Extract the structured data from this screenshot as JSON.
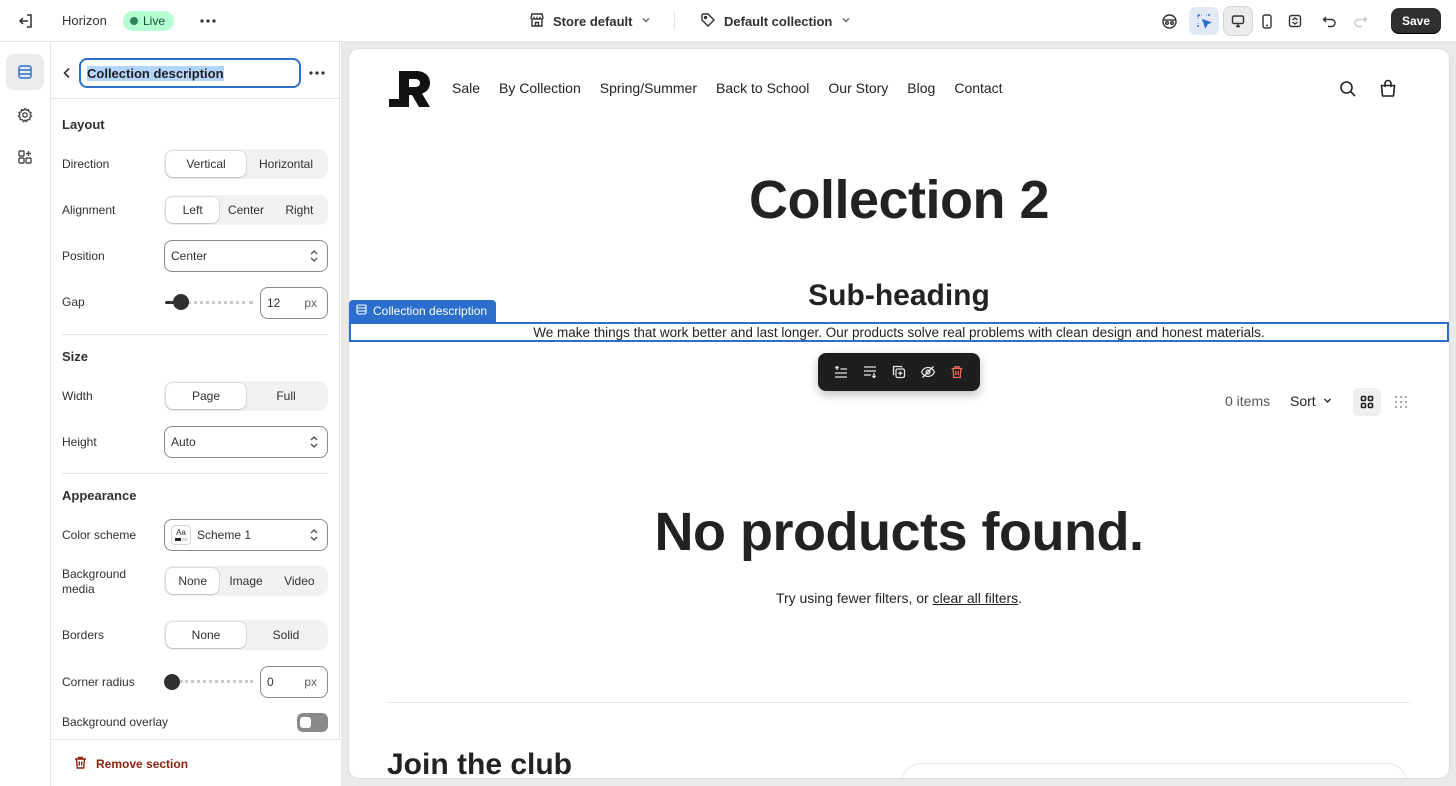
{
  "topbar": {
    "theme_name": "Horizon",
    "live_label": "Live",
    "store_select": "Store default",
    "collection_select": "Default collection",
    "save_label": "Save"
  },
  "panel": {
    "title_value": "Collection description",
    "layout": {
      "title": "Layout",
      "direction_label": "Direction",
      "direction_options": [
        "Vertical",
        "Horizontal"
      ],
      "direction_selected": "Vertical",
      "alignment_label": "Alignment",
      "alignment_options": [
        "Left",
        "Center",
        "Right"
      ],
      "alignment_selected": "Left",
      "position_label": "Position",
      "position_value": "Center",
      "gap_label": "Gap",
      "gap_value": "12",
      "gap_unit": "px"
    },
    "size": {
      "title": "Size",
      "width_label": "Width",
      "width_options": [
        "Page",
        "Full"
      ],
      "width_selected": "Page",
      "height_label": "Height",
      "height_value": "Auto"
    },
    "appearance": {
      "title": "Appearance",
      "color_scheme_label": "Color scheme",
      "color_scheme_swatch": "Aa",
      "color_scheme_value": "Scheme 1",
      "bg_media_label": "Background media",
      "bg_media_options": [
        "None",
        "Image",
        "Video"
      ],
      "bg_media_selected": "None",
      "borders_label": "Borders",
      "borders_options": [
        "None",
        "Solid"
      ],
      "borders_selected": "None",
      "corner_radius_label": "Corner radius",
      "corner_radius_value": "0",
      "corner_radius_unit": "px",
      "bg_overlay_label": "Background overlay",
      "bg_overlay_on": false
    },
    "remove_label": "Remove section"
  },
  "preview": {
    "nav": [
      "Sale",
      "By Collection",
      "Spring/Summer",
      "Back to School",
      "Our Story",
      "Blog",
      "Contact"
    ],
    "collection_title": "Collection 2",
    "sub_heading": "Sub-heading",
    "selection_tag": "Collection description",
    "description": "We make things that work better and last longer. Our products solve real problems with clean design and honest materials.",
    "items_count": "0 items",
    "sort_label": "Sort",
    "no_products": "No products found.",
    "try_text": "Try using fewer filters, or ",
    "clear_filters": "clear all filters",
    "try_end": ".",
    "join_title": "Join the club"
  },
  "colors": {
    "accent": "#2c6ecb",
    "live_bg": "#b4fed2",
    "danger": "#8e1f0b",
    "dark": "#303030"
  },
  "icons": [
    "exit-icon",
    "more-icon",
    "store-icon",
    "tag-icon",
    "chevron-down-icon",
    "inspector-icon",
    "select-icon",
    "desktop-icon",
    "mobile-icon",
    "fullscreen-icon",
    "undo-icon",
    "redo-icon",
    "sections-icon",
    "settings-icon",
    "apps-icon",
    "back-icon",
    "search-icon",
    "cart-icon",
    "trash-icon",
    "move-up-icon",
    "move-down-icon",
    "duplicate-icon",
    "hide-icon",
    "grid-icon",
    "dense-grid-icon"
  ]
}
